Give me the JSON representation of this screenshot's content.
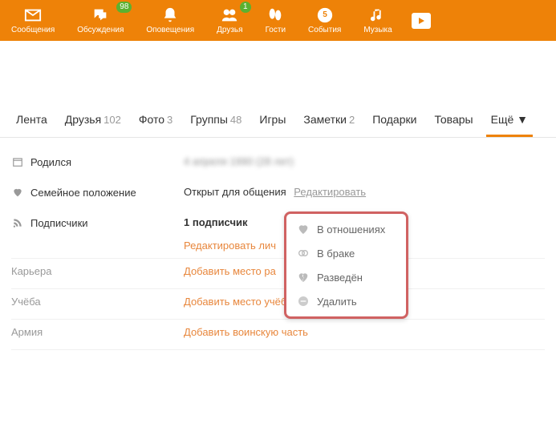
{
  "topnav": {
    "items": [
      {
        "label": "Сообщения",
        "icon": "mail"
      },
      {
        "label": "Обсуждения",
        "icon": "chat",
        "badge": "98"
      },
      {
        "label": "Оповещения",
        "icon": "bell"
      },
      {
        "label": "Друзья",
        "icon": "friends",
        "badge": "1"
      },
      {
        "label": "Гости",
        "icon": "shoes"
      },
      {
        "label": "События",
        "icon": "events"
      },
      {
        "label": "Музыка",
        "icon": "music"
      }
    ]
  },
  "tabs": [
    {
      "label": "Лента"
    },
    {
      "label": "Друзья",
      "count": "102"
    },
    {
      "label": "Фото",
      "count": "3"
    },
    {
      "label": "Группы",
      "count": "48"
    },
    {
      "label": "Игры"
    },
    {
      "label": "Заметки",
      "count": "2"
    },
    {
      "label": "Подарки"
    },
    {
      "label": "Товары"
    },
    {
      "label": "Ещё ▼",
      "active": true
    }
  ],
  "info": {
    "born_label": "Родился",
    "born_value": "4 апреля 1990 (28 лет)",
    "status_label": "Семейное положение",
    "status_value": "Открыт для общения",
    "status_edit": "Редактировать",
    "subs_label": "Подписчики",
    "subs_value": "1 подписчик",
    "edit_personal": "Редактировать лич",
    "career_label": "Карьера",
    "career_link": "Добавить место ра",
    "study_label": "Учёба",
    "study_link": "Добавить место учёбы",
    "army_label": "Армия",
    "army_link": "Добавить воинскую часть"
  },
  "popup": {
    "items": [
      {
        "label": "В отношениях",
        "icon": "heart"
      },
      {
        "label": "В браке",
        "icon": "rings"
      },
      {
        "label": "Разведён",
        "icon": "broken"
      },
      {
        "label": "Удалить",
        "icon": "minus"
      }
    ]
  }
}
